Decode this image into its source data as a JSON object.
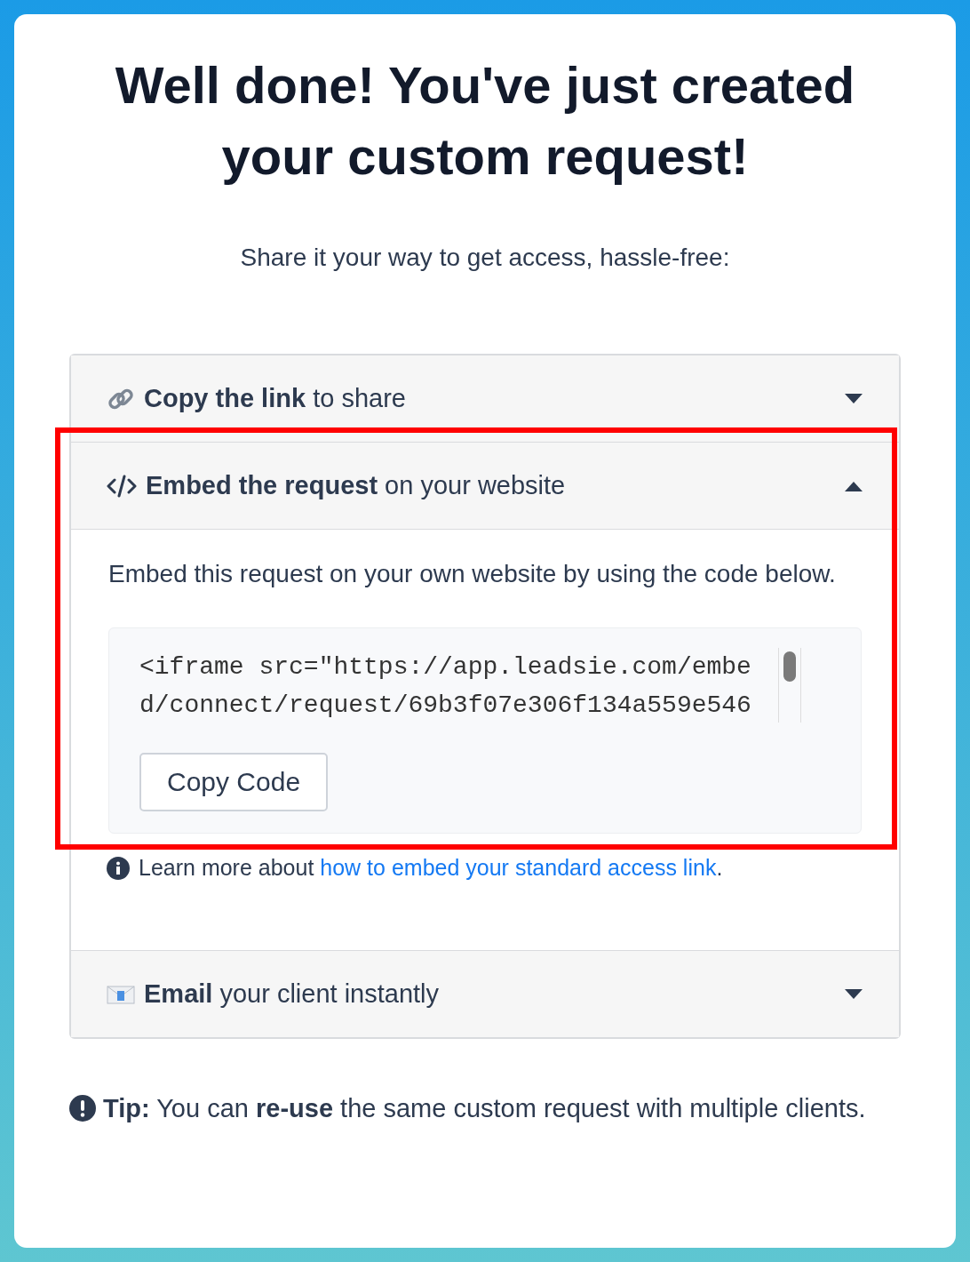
{
  "heading": "Well done! You've just created your custom request!",
  "subtitle": "Share it your way to get access, hassle-free:",
  "sections": [
    {
      "kind": "link",
      "title": "**Copy the link** to share",
      "expanded": false,
      "highlighted": false
    },
    {
      "kind": "embed",
      "title": "**Embed the request** on your website",
      "expanded": true,
      "highlighted": true,
      "description": "Embed this request on your own website by using the code below.",
      "code": "<iframe src=\"https://app.leadsie.com/embed/connect/request/69b3f07e306f134a559e546",
      "button": "Copy Code",
      "note": "Learn more about",
      "note_link": "how to embed your standard access link",
      "note_end": "."
    },
    {
      "kind": "email",
      "title": "**Email** your client instantly",
      "expanded": false,
      "highlighted": false
    }
  ],
  "tip": "**Tip:** You can **re-use** the same custom request with multiple clients."
}
